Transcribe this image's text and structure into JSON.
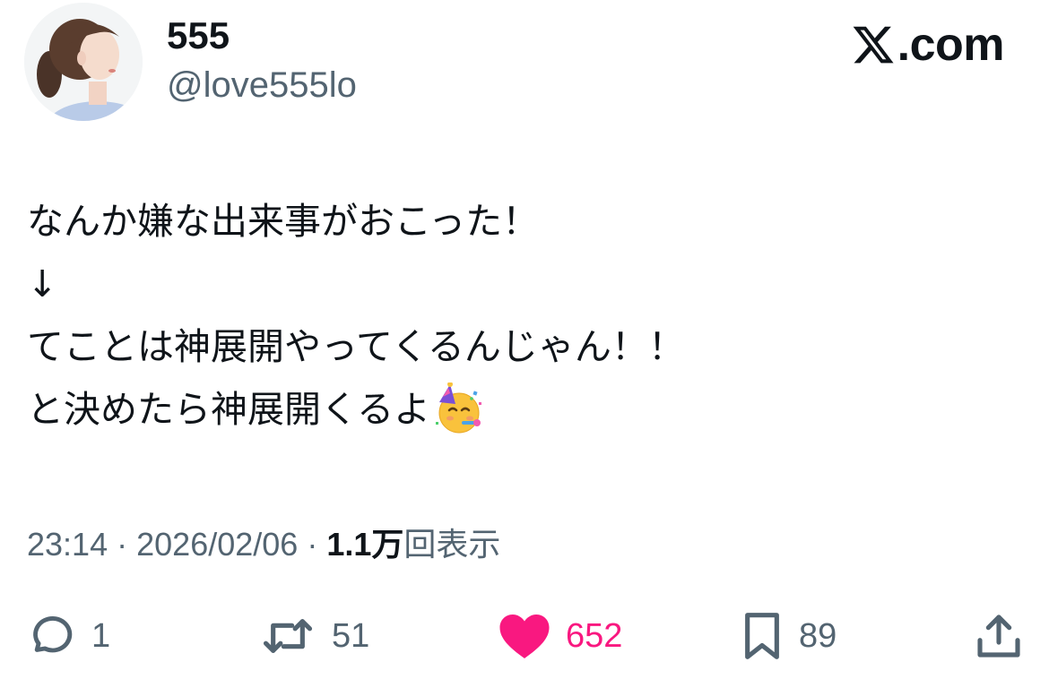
{
  "author": {
    "display_name": "555",
    "handle": "@love555lo"
  },
  "brand": {
    "label": ".com",
    "icon": "x-logo-icon"
  },
  "tweet": {
    "lines": [
      "なんか嫌な出来事がおこった！",
      "↓",
      "てことは神展開やってくるんじゃん！！",
      "と決めたら神展開くるよ"
    ],
    "emoji": "partying-face-icon"
  },
  "meta": {
    "time": "23:14",
    "separator": "·",
    "date": "2026/02/06",
    "views_count": "1.1万",
    "views_suffix": "回表示"
  },
  "actions": {
    "replies": "1",
    "reposts": "51",
    "likes": "652",
    "bookmarks": "89"
  },
  "colors": {
    "text": "#0f1419",
    "secondary": "#536471",
    "like": "#f91880",
    "background": "#ffffff"
  }
}
